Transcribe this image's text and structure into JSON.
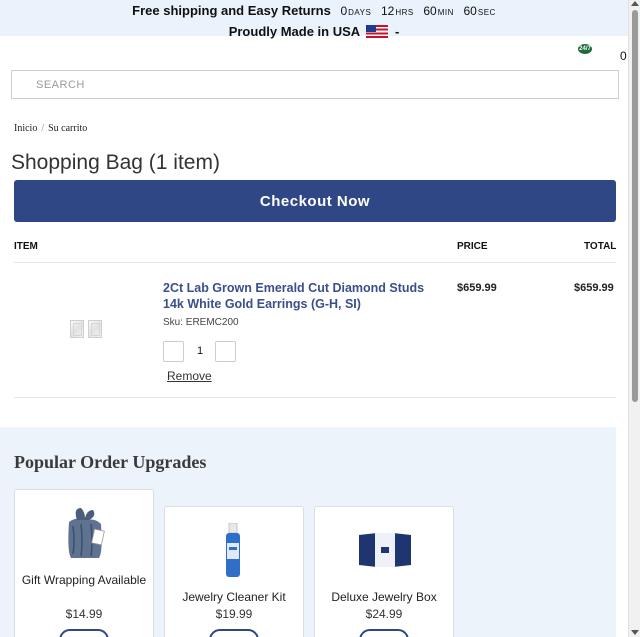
{
  "banner": {
    "shipping_text": "Free shipping and Easy Returns",
    "countdown": [
      {
        "value": "0",
        "unit": "DAYS"
      },
      {
        "value": "12",
        "unit": "HRS"
      },
      {
        "value": "60",
        "unit": "MIN"
      },
      {
        "value": "60",
        "unit": "SEC"
      }
    ],
    "made_in_text": "Proudly Made in USA",
    "made_in_suffix": "-"
  },
  "header": {
    "support_badge": "24/7",
    "cart_count": "0"
  },
  "search": {
    "placeholder": "SEARCH"
  },
  "breadcrumb": {
    "home": "Inicio",
    "separator": "/",
    "current": "Su carrito"
  },
  "page": {
    "title": "Shopping Bag (1 item)",
    "checkout_label": "Checkout Now"
  },
  "table": {
    "columns": {
      "item": "ITEM",
      "price": "PRICE",
      "total": "TOTAL"
    },
    "rows": [
      {
        "name": "2Ct Lab Grown Emerald Cut Diamond Studs 14k White Gold Earrings (G-H, SI)",
        "sku": "Sku: EREMC200",
        "quantity": "1",
        "price": "$659.99",
        "total": "$659.99",
        "remove_label": "Remove"
      }
    ]
  },
  "upgrades": {
    "title": "Popular Order Upgrades",
    "items": [
      {
        "name": "Gift Wrapping Available",
        "price": "$14.99",
        "icon": "gift-bag-icon"
      },
      {
        "name": "Jewelry Cleaner Kit",
        "price": "$19.99",
        "icon": "cleaner-bottle-icon"
      },
      {
        "name": "Deluxe Jewelry Box",
        "price": "$24.99",
        "icon": "jewelry-box-icon"
      }
    ]
  },
  "colors": {
    "brand_blue": "#2f4784",
    "banner_bg": "#eaf2fb",
    "upgrades_bg": "#edf3fb",
    "link_blue": "#3a4f8c"
  }
}
